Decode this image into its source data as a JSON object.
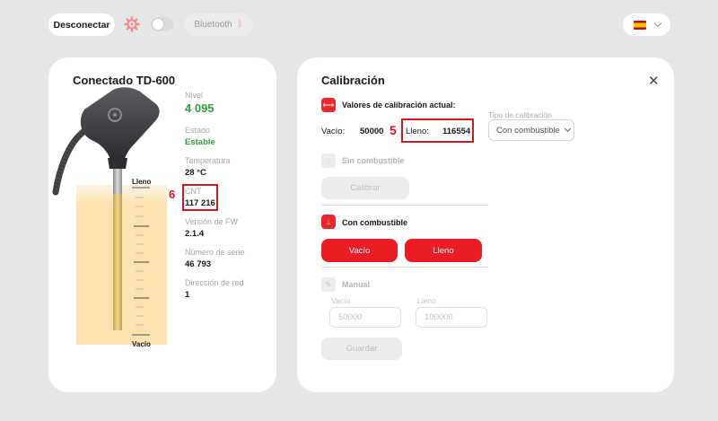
{
  "topbar": {
    "disconnect_label": "Desconectar",
    "bluetooth_label": "Bluetooth",
    "language_flag": "es",
    "accent_color": "#ec1c24"
  },
  "device": {
    "title": "Conectado  TD-600",
    "scale_top": "Lleno",
    "scale_bottom": "Vacío",
    "info": [
      {
        "label": "Nivel",
        "value": "4 095"
      },
      {
        "label": "Estado",
        "value": "Estable"
      },
      {
        "label": "Temperatura",
        "value": "28 °C"
      },
      {
        "label": "CNT",
        "value": "117 216"
      },
      {
        "label": "Versión de FW",
        "value": "2.1.4"
      },
      {
        "label": "Número de serie",
        "value": "46 793"
      },
      {
        "label": "Dirección de red",
        "value": "1"
      }
    ],
    "annotation_number": "6"
  },
  "calibration": {
    "title": "Calibración",
    "current_label": "Valores de calibración actual:",
    "empty_label": "Vacío:",
    "empty_value": "50000",
    "full_label": "Lleno:",
    "full_value": "116554",
    "annotation_number": "5",
    "type_label": "Tipo de calibración",
    "type_value": "Con combustible",
    "no_fuel": {
      "label": "Sin combustible",
      "button": "Calibrar"
    },
    "with_fuel": {
      "label": "Con combustible",
      "empty_button": "Vacío",
      "full_button": "Lleno"
    },
    "manual": {
      "label": "Manual",
      "empty_field_label": "Vacío",
      "empty_placeholder": "50000",
      "full_field_label": "Lleno",
      "full_placeholder": "100000",
      "save_button": "Guardar"
    }
  }
}
